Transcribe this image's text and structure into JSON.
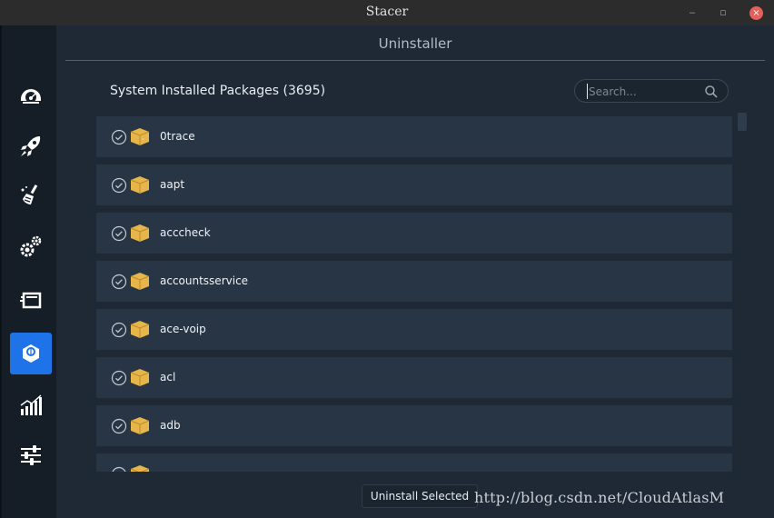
{
  "window": {
    "title": "Stacer",
    "minimize": "‒",
    "maximize": "▫",
    "close": "×"
  },
  "sidebar": {
    "items": [
      {
        "icon": "dashboard-icon",
        "active": false
      },
      {
        "icon": "startup-rocket-icon",
        "active": false
      },
      {
        "icon": "cleaner-broom-icon",
        "active": false
      },
      {
        "icon": "services-gears-icon",
        "active": false
      },
      {
        "icon": "processes-icon",
        "active": false
      },
      {
        "icon": "uninstaller-icon",
        "active": true
      },
      {
        "icon": "resources-chart-icon",
        "active": false
      },
      {
        "icon": "settings-sliders-icon",
        "active": false
      }
    ]
  },
  "header": {
    "title": "Uninstaller"
  },
  "packages": {
    "title": "System Installed Packages (3695)",
    "search_placeholder": "Search...",
    "items": [
      {
        "name": "0trace",
        "checked": true
      },
      {
        "name": "aapt",
        "checked": true
      },
      {
        "name": "acccheck",
        "checked": true
      },
      {
        "name": "accountsservice",
        "checked": true
      },
      {
        "name": "ace-voip",
        "checked": true
      },
      {
        "name": "acl",
        "checked": true
      },
      {
        "name": "adb",
        "checked": true
      },
      {
        "name": "",
        "checked": true
      }
    ]
  },
  "footer": {
    "uninstall_label": "Uninstall Selected",
    "watermark": "http://blog.csdn.net/CloudAtlasM"
  },
  "colors": {
    "accent": "#1e73e8",
    "row_bg": "#283544",
    "package_icon": "#e7b64b",
    "close_button": "#e65f5a"
  }
}
